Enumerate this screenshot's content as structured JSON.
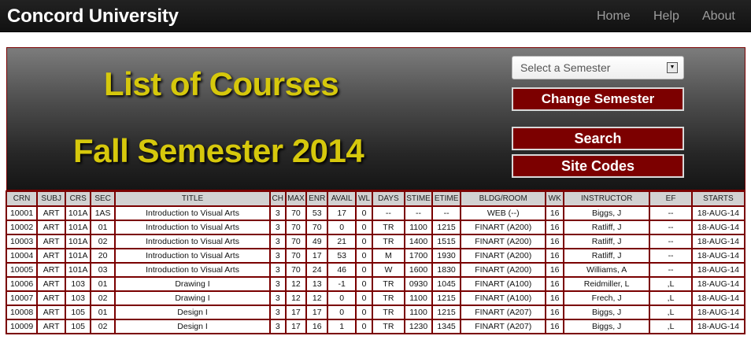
{
  "navbar": {
    "brand": "Concord University",
    "links": [
      "Home",
      "Help",
      "About"
    ]
  },
  "banner": {
    "title_line1": "List of Courses",
    "title_line2": "Fall Semester 2014"
  },
  "controls": {
    "semester_select_value": "Select a Semester",
    "change_semester_label": "Change Semester",
    "search_label": "Search",
    "site_codes_label": "Site Codes"
  },
  "colors": {
    "accent_red": "#7c0000",
    "title_yellow": "#d6c80c",
    "navbar_bg": "#1a1a1a"
  },
  "table": {
    "headers": [
      "CRN",
      "SUBJ",
      "CRS",
      "SEC",
      "TITLE",
      "CH",
      "MAX",
      "ENR",
      "AVAIL",
      "WL",
      "DAYS",
      "STIME",
      "ETIME",
      "BLDG/ROOM",
      "WK",
      "INSTRUCTOR",
      "EF",
      "STARTS"
    ],
    "rows": [
      [
        "10001",
        "ART",
        "101A",
        "1AS",
        "Introduction to Visual Arts",
        "3",
        "70",
        "53",
        "17",
        "0",
        "--",
        "--",
        "--",
        "WEB (--)",
        "16",
        "Biggs, J",
        "--",
        "18-AUG-14"
      ],
      [
        "10002",
        "ART",
        "101A",
        "01",
        "Introduction to Visual Arts",
        "3",
        "70",
        "70",
        "0",
        "0",
        "TR",
        "1100",
        "1215",
        "FINART (A200)",
        "16",
        "Ratliff, J",
        "--",
        "18-AUG-14"
      ],
      [
        "10003",
        "ART",
        "101A",
        "02",
        "Introduction to Visual Arts",
        "3",
        "70",
        "49",
        "21",
        "0",
        "TR",
        "1400",
        "1515",
        "FINART (A200)",
        "16",
        "Ratliff, J",
        "--",
        "18-AUG-14"
      ],
      [
        "10004",
        "ART",
        "101A",
        "20",
        "Introduction to Visual Arts",
        "3",
        "70",
        "17",
        "53",
        "0",
        "M",
        "1700",
        "1930",
        "FINART (A200)",
        "16",
        "Ratliff, J",
        "--",
        "18-AUG-14"
      ],
      [
        "10005",
        "ART",
        "101A",
        "03",
        "Introduction to Visual Arts",
        "3",
        "70",
        "24",
        "46",
        "0",
        "W",
        "1600",
        "1830",
        "FINART (A200)",
        "16",
        "Williams, A",
        "--",
        "18-AUG-14"
      ],
      [
        "10006",
        "ART",
        "103",
        "01",
        "Drawing I",
        "3",
        "12",
        "13",
        "-1",
        "0",
        "TR",
        "0930",
        "1045",
        "FINART (A100)",
        "16",
        "Reidmiller, L",
        ",L",
        "18-AUG-14"
      ],
      [
        "10007",
        "ART",
        "103",
        "02",
        "Drawing I",
        "3",
        "12",
        "12",
        "0",
        "0",
        "TR",
        "1100",
        "1215",
        "FINART (A100)",
        "16",
        "Frech, J",
        ",L",
        "18-AUG-14"
      ],
      [
        "10008",
        "ART",
        "105",
        "01",
        "Design I",
        "3",
        "17",
        "17",
        "0",
        "0",
        "TR",
        "1100",
        "1215",
        "FINART (A207)",
        "16",
        "Biggs, J",
        ",L",
        "18-AUG-14"
      ],
      [
        "10009",
        "ART",
        "105",
        "02",
        "Design I",
        "3",
        "17",
        "16",
        "1",
        "0",
        "TR",
        "1230",
        "1345",
        "FINART (A207)",
        "16",
        "Biggs, J",
        ",L",
        "18-AUG-14"
      ]
    ]
  }
}
